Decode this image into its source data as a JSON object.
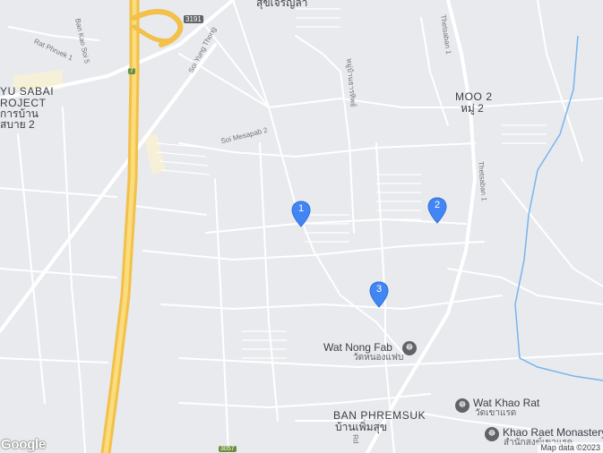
{
  "areas": {
    "moo2": "MOO 2",
    "moo2_thai": "หมู่ 2",
    "ban_phremsuk": "BAN PHREMSUK",
    "ban_phremsuk_thai": "บ้านเพิ่มสุข",
    "yusabai_1": "YU SABAI",
    "yusabai_2": "ROJECT",
    "yusabai_3": "การบ้าน",
    "yusabai_4": "สบาย 2",
    "top_thai": "สุขเจริญลา"
  },
  "pois": {
    "wat_nong_fab": "Wat Nong Fab",
    "wat_nong_fab_thai": "วัดหนองแฟบ",
    "wat_khao_rat": "Wat Khao Rat",
    "wat_khao_rat_thai": "วัดเขาแรด",
    "khao_raet": "Khao Raet Monastery",
    "khao_raet_thai": "สำนักสงฆ์เขาแรด"
  },
  "roads": {
    "ban_kao_soi_5": "Ban Kao Soi 5",
    "rat_phruek": "Rat Phruek 1",
    "soi_yung_thong": "Soi Yung Thong",
    "soi_mesapab": "Soi Mesapab 2",
    "thetsaban_1": "Thetsaban 1",
    "thetsaban_1b": "Thetsaban 1",
    "moo_road": "หมู่บ้านธารทิพย์",
    "rd": "Rd"
  },
  "shields": {
    "route_7": "7",
    "route_3191": "3191",
    "route_3057": "3057"
  },
  "markers": [
    {
      "label": "1",
      "color": "#4285f4"
    },
    {
      "label": "2",
      "color": "#4285f4"
    },
    {
      "label": "3",
      "color": "#4285f4"
    }
  ],
  "branding": {
    "google": "Google",
    "attribution": "Map data ©2023"
  },
  "colors": {
    "background": "#e8eaed",
    "road": "#ffffff",
    "highway": "#f2c04b",
    "water": "#78b4f0",
    "marker": "#4285f4"
  }
}
